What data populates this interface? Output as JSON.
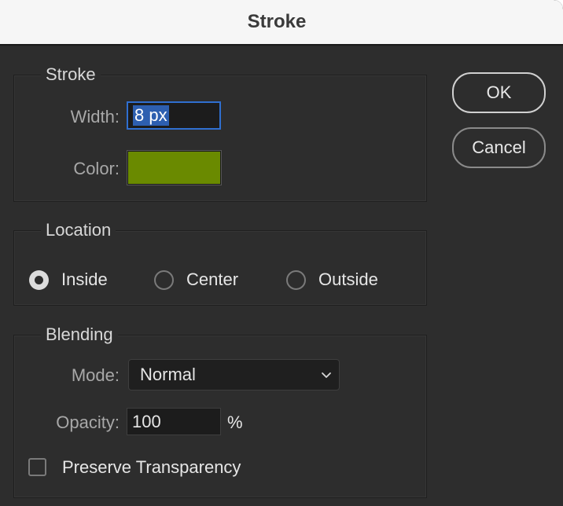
{
  "window": {
    "title": "Stroke"
  },
  "stroke_group": {
    "label": "Stroke",
    "width_label": "Width:",
    "width_value": "8 px",
    "color_label": "Color:",
    "color_value": "#6a8a00"
  },
  "location_group": {
    "label": "Location",
    "options": [
      {
        "label": "Inside",
        "checked": true
      },
      {
        "label": "Center",
        "checked": false
      },
      {
        "label": "Outside",
        "checked": false
      }
    ]
  },
  "blending_group": {
    "label": "Blending",
    "mode_label": "Mode:",
    "mode_value": "Normal",
    "opacity_label": "Opacity:",
    "opacity_value": "100",
    "opacity_unit": "%",
    "preserve_label": "Preserve Transparency",
    "preserve_checked": false
  },
  "buttons": {
    "ok": "OK",
    "cancel": "Cancel"
  }
}
